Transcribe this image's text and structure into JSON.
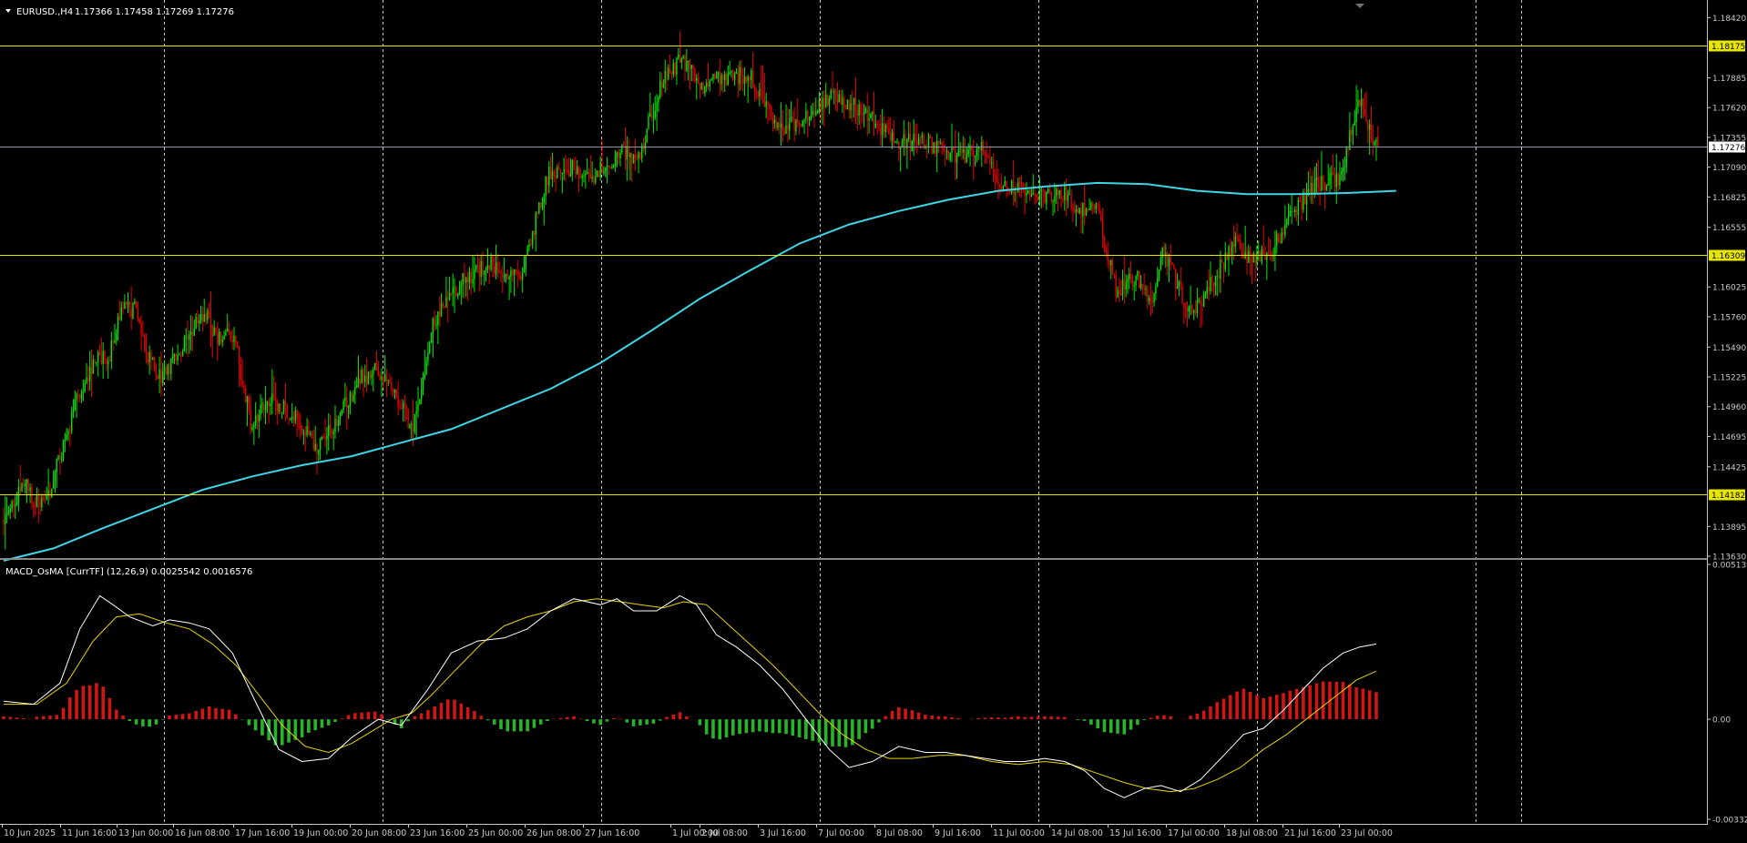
{
  "symbol_header": {
    "symbol": "EURUSD.,H4",
    "ohlc": "1.17366 1.17458 1.17269 1.17276"
  },
  "osc_header": {
    "name": "MACD_OsMA [CurrTF] (12,26,9)",
    "values": "0.0025542 0.0016576"
  },
  "price_axis": {
    "ticks": [
      "1.18420",
      "1.17885",
      "1.17620",
      "1.17355",
      "1.17090",
      "1.16825",
      "1.16555",
      "1.16025",
      "1.15760",
      "1.15490",
      "1.15225",
      "1.14960",
      "1.14695",
      "1.14425",
      "1.13895",
      "1.13630"
    ],
    "horizontal_levels": [
      {
        "price": "1.18175",
        "color": "#e6e600"
      },
      {
        "price": "1.16309",
        "color": "#e6e600"
      },
      {
        "price": "1.14182",
        "color": "#e6e600"
      }
    ],
    "current_price": {
      "price": "1.17276",
      "color": "#8a96a8"
    }
  },
  "osc_axis": {
    "ticks": [
      "0.0051399",
      "0.00",
      "-0.003320"
    ]
  },
  "time_axis": {
    "labels": [
      "10 Jun 2025",
      "11 Jun 16:00",
      "13 Jun 00:00",
      "16 Jun 08:00",
      "17 Jun 16:00",
      "19 Jun 00:00",
      "20 Jun 08:00",
      "23 Jun 16:00",
      "25 Jun 00:00",
      "26 Jun 08:00",
      "27 Jun 16:00",
      "1 Jul 00:00",
      "2 Jul 08:00",
      "3 Jul 16:00",
      "7 Jul 00:00",
      "8 Jul 08:00",
      "9 Jul 16:00",
      "11 Jul 00:00",
      "14 Jul 08:00",
      "15 Jul 16:00",
      "17 Jul 00:00",
      "18 Jul 08:00",
      "21 Jul 16:00",
      "23 Jul 00:00"
    ]
  },
  "colors": {
    "background": "#000000",
    "bull": "#00e600",
    "bear": "#e60000",
    "ma": "#3cd6e6",
    "grid": "#c8c8c8",
    "axis_text": "#c8c8c8",
    "level": "#e6e600",
    "macd_line": "#ffffff",
    "signal_line": "#e6d200",
    "hist_pos": "#d21414",
    "hist_neg": "#28b428"
  },
  "chart_data": [
    {
      "type": "candlestick",
      "title": "EURUSD.,H4",
      "ylim": [
        1.1363,
        1.1852
      ],
      "moving_average_path": [
        [
          0,
          1.1359
        ],
        [
          30,
          1.137
        ],
        [
          60,
          1.1388
        ],
        [
          90,
          1.1405
        ],
        [
          120,
          1.1422
        ],
        [
          150,
          1.1434
        ],
        [
          180,
          1.1444
        ],
        [
          210,
          1.1452
        ],
        [
          240,
          1.1464
        ],
        [
          270,
          1.1476
        ],
        [
          300,
          1.1494
        ],
        [
          330,
          1.1512
        ],
        [
          360,
          1.1535
        ],
        [
          390,
          1.1563
        ],
        [
          420,
          1.1592
        ],
        [
          450,
          1.1617
        ],
        [
          480,
          1.1641
        ],
        [
          510,
          1.1658
        ],
        [
          540,
          1.167
        ],
        [
          570,
          1.168
        ],
        [
          600,
          1.1688
        ],
        [
          630,
          1.1692
        ],
        [
          660,
          1.1695
        ],
        [
          690,
          1.1694
        ],
        [
          720,
          1.1688
        ],
        [
          750,
          1.1685
        ],
        [
          780,
          1.1685
        ],
        [
          810,
          1.1686
        ],
        [
          840,
          1.1688
        ]
      ],
      "waypoints": [
        [
          0,
          1.1395
        ],
        [
          14,
          1.1428
        ],
        [
          20,
          1.141
        ],
        [
          28,
          1.1418
        ],
        [
          44,
          1.1496
        ],
        [
          56,
          1.154
        ],
        [
          64,
          1.1538
        ],
        [
          72,
          1.1584
        ],
        [
          80,
          1.1582
        ],
        [
          86,
          1.1548
        ],
        [
          96,
          1.152
        ],
        [
          110,
          1.155
        ],
        [
          122,
          1.1581
        ],
        [
          128,
          1.156
        ],
        [
          140,
          1.1557
        ],
        [
          150,
          1.1483
        ],
        [
          162,
          1.1504
        ],
        [
          178,
          1.1487
        ],
        [
          190,
          1.1455
        ],
        [
          206,
          1.1495
        ],
        [
          216,
          1.152
        ],
        [
          226,
          1.153
        ],
        [
          236,
          1.151
        ],
        [
          248,
          1.1475
        ],
        [
          260,
          1.157
        ],
        [
          276,
          1.1606
        ],
        [
          294,
          1.1625
        ],
        [
          312,
          1.1608
        ],
        [
          330,
          1.1705
        ],
        [
          346,
          1.1708
        ],
        [
          356,
          1.17
        ],
        [
          374,
          1.1722
        ],
        [
          384,
          1.1717
        ],
        [
          398,
          1.1785
        ],
        [
          410,
          1.1806
        ],
        [
          424,
          1.178
        ],
        [
          436,
          1.179
        ],
        [
          452,
          1.179
        ],
        [
          470,
          1.174
        ],
        [
          480,
          1.175
        ],
        [
          496,
          1.177
        ],
        [
          510,
          1.1768
        ],
        [
          524,
          1.1754
        ],
        [
          540,
          1.173
        ],
        [
          556,
          1.1732
        ],
        [
          570,
          1.172
        ],
        [
          580,
          1.1719
        ],
        [
          592,
          1.173
        ],
        [
          602,
          1.1692
        ],
        [
          618,
          1.169
        ],
        [
          630,
          1.1684
        ],
        [
          640,
          1.1687
        ],
        [
          652,
          1.167
        ],
        [
          660,
          1.1675
        ],
        [
          672,
          1.16
        ],
        [
          684,
          1.1612
        ],
        [
          694,
          1.1584
        ],
        [
          700,
          1.164
        ],
        [
          712,
          1.1592
        ],
        [
          720,
          1.158
        ],
        [
          734,
          1.1618
        ],
        [
          744,
          1.164
        ],
        [
          756,
          1.1625
        ],
        [
          766,
          1.1634
        ],
        [
          778,
          1.1668
        ],
        [
          792,
          1.1692
        ],
        [
          808,
          1.17
        ],
        [
          818,
          1.177
        ],
        [
          828,
          1.1731
        ]
      ]
    },
    {
      "type": "bar",
      "title": "MACD_OsMA [CurrTF] (12,26,9)",
      "ylim": [
        -0.00332,
        0.0051399
      ],
      "macd_points": [
        [
          0,
          0.0006
        ],
        [
          18,
          0.0005
        ],
        [
          34,
          0.0012
        ],
        [
          46,
          0.003
        ],
        [
          58,
          0.0041
        ],
        [
          66,
          0.0038
        ],
        [
          76,
          0.0034
        ],
        [
          90,
          0.0031
        ],
        [
          100,
          0.0033
        ],
        [
          112,
          0.0032
        ],
        [
          124,
          0.003
        ],
        [
          138,
          0.0022
        ],
        [
          150,
          0.0008
        ],
        [
          166,
          -0.001
        ],
        [
          180,
          -0.0014
        ],
        [
          196,
          -0.0013
        ],
        [
          210,
          -0.0006
        ],
        [
          226,
          0.0
        ],
        [
          240,
          -0.0002
        ],
        [
          256,
          0.001
        ],
        [
          270,
          0.0022
        ],
        [
          286,
          0.0026
        ],
        [
          302,
          0.0027
        ],
        [
          316,
          0.003
        ],
        [
          330,
          0.0036
        ],
        [
          344,
          0.004
        ],
        [
          360,
          0.0038
        ],
        [
          370,
          0.004
        ],
        [
          380,
          0.0036
        ],
        [
          394,
          0.0036
        ],
        [
          408,
          0.0041
        ],
        [
          418,
          0.0038
        ],
        [
          430,
          0.0028
        ],
        [
          442,
          0.0024
        ],
        [
          456,
          0.0018
        ],
        [
          470,
          0.001
        ],
        [
          484,
          0.0
        ],
        [
          498,
          -0.001
        ],
        [
          510,
          -0.0016
        ],
        [
          524,
          -0.0014
        ],
        [
          540,
          -0.0009
        ],
        [
          556,
          -0.0011
        ],
        [
          568,
          -0.0011
        ],
        [
          580,
          -0.0012
        ],
        [
          592,
          -0.0013
        ],
        [
          604,
          -0.0014
        ],
        [
          616,
          -0.0014
        ],
        [
          628,
          -0.0013
        ],
        [
          640,
          -0.0014
        ],
        [
          652,
          -0.0017
        ],
        [
          664,
          -0.0023
        ],
        [
          676,
          -0.0026
        ],
        [
          688,
          -0.0023
        ],
        [
          698,
          -0.0022
        ],
        [
          710,
          -0.0024
        ],
        [
          722,
          -0.002
        ],
        [
          736,
          -0.0012
        ],
        [
          748,
          -0.0005
        ],
        [
          760,
          -0.0003
        ],
        [
          772,
          0.0003
        ],
        [
          784,
          0.001
        ],
        [
          796,
          0.0017
        ],
        [
          808,
          0.0022
        ],
        [
          818,
          0.0024
        ],
        [
          828,
          0.0025
        ]
      ],
      "signal_points": [
        [
          0,
          0.0005
        ],
        [
          20,
          0.0005
        ],
        [
          38,
          0.0012
        ],
        [
          54,
          0.0026
        ],
        [
          68,
          0.0034
        ],
        [
          82,
          0.0035
        ],
        [
          98,
          0.0032
        ],
        [
          112,
          0.003
        ],
        [
          126,
          0.0025
        ],
        [
          140,
          0.0018
        ],
        [
          154,
          0.0008
        ],
        [
          168,
          -0.0002
        ],
        [
          182,
          -0.0009
        ],
        [
          196,
          -0.0011
        ],
        [
          210,
          -0.0008
        ],
        [
          222,
          -0.0004
        ],
        [
          234,
          0.0
        ],
        [
          246,
          0.0002
        ],
        [
          258,
          0.0008
        ],
        [
          272,
          0.0016
        ],
        [
          288,
          0.0025
        ],
        [
          302,
          0.0031
        ],
        [
          316,
          0.0034
        ],
        [
          330,
          0.0036
        ],
        [
          344,
          0.0039
        ],
        [
          358,
          0.004
        ],
        [
          372,
          0.0039
        ],
        [
          384,
          0.0038
        ],
        [
          398,
          0.0037
        ],
        [
          410,
          0.0039
        ],
        [
          424,
          0.0038
        ],
        [
          436,
          0.0032
        ],
        [
          450,
          0.0025
        ],
        [
          464,
          0.0018
        ],
        [
          478,
          0.001
        ],
        [
          492,
          0.0002
        ],
        [
          506,
          -0.0005
        ],
        [
          520,
          -0.001
        ],
        [
          534,
          -0.0013
        ],
        [
          548,
          -0.0013
        ],
        [
          564,
          -0.0012
        ],
        [
          580,
          -0.0012
        ],
        [
          596,
          -0.0014
        ],
        [
          612,
          -0.0015
        ],
        [
          628,
          -0.0014
        ],
        [
          644,
          -0.0015
        ],
        [
          660,
          -0.0018
        ],
        [
          676,
          -0.0021
        ],
        [
          690,
          -0.0023
        ],
        [
          704,
          -0.0024
        ],
        [
          718,
          -0.0023
        ],
        [
          732,
          -0.002
        ],
        [
          746,
          -0.0016
        ],
        [
          760,
          -0.001
        ],
        [
          774,
          -0.0005
        ],
        [
          788,
          0.0001
        ],
        [
          802,
          0.0007
        ],
        [
          816,
          0.0013
        ],
        [
          828,
          0.0016
        ]
      ]
    }
  ]
}
